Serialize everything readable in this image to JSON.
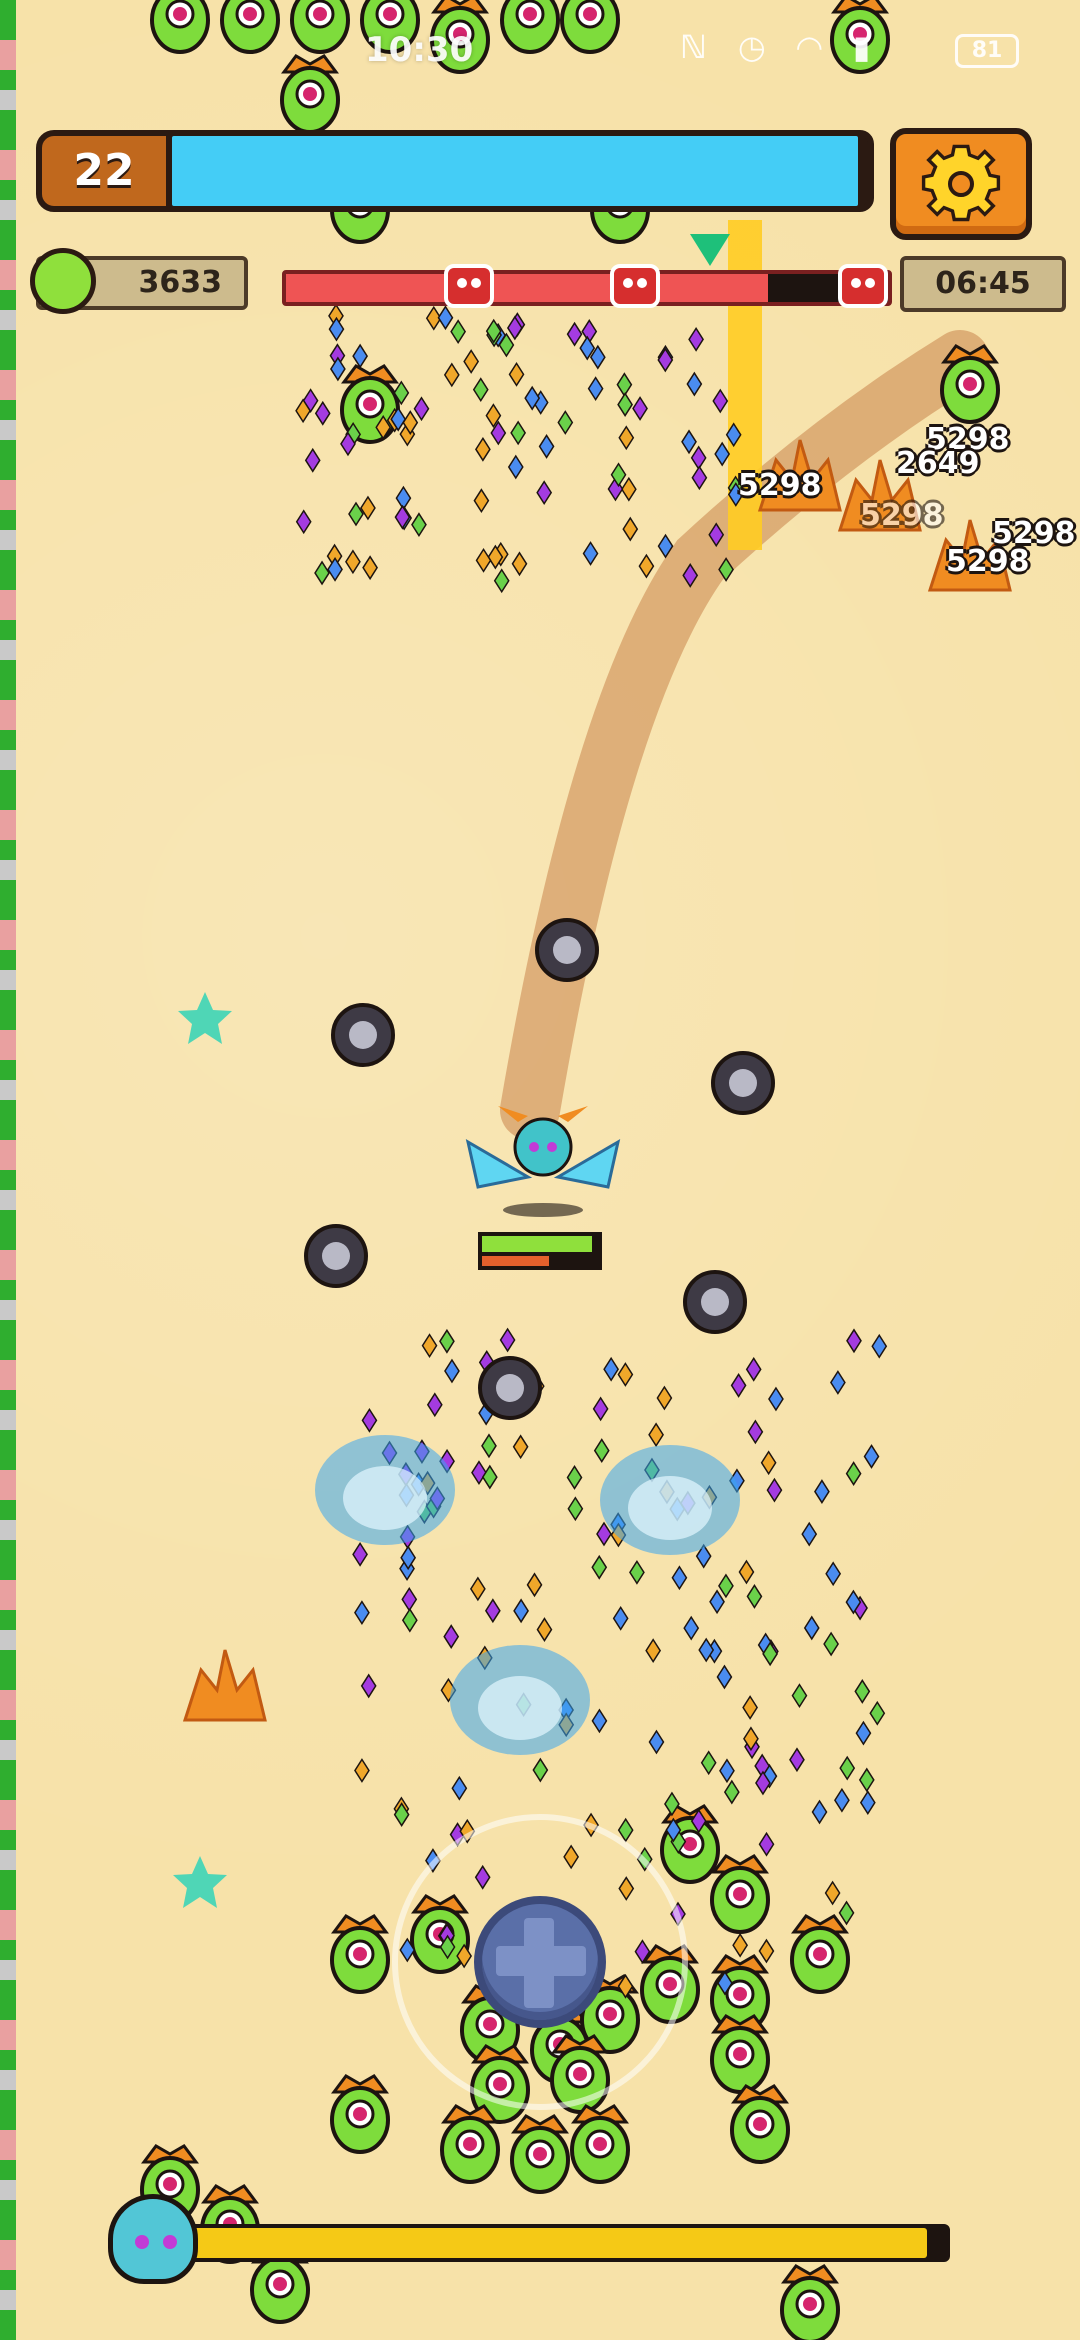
{
  "status_bar": {
    "time": "10:30",
    "icons": [
      "nfc-icon",
      "alarm-icon",
      "wifi-icon",
      "signal-icon"
    ],
    "battery": "81"
  },
  "hud": {
    "level": "22",
    "xp_progress": 0.985,
    "gems": "3633",
    "timer": "06:45",
    "boss_progress": 0.8,
    "settings_icon": "gear-icon"
  },
  "damage_numbers": [
    "5298",
    "2649",
    "5298",
    "5298",
    "5298",
    "5298"
  ],
  "player": {
    "hp_progress": 0.95
  },
  "hero_bar": {
    "progress": 0.975
  },
  "colors": {
    "sand": "#f7e2a9",
    "xp": "#44cdf6",
    "boss": "#ef5454",
    "hp": "#8fe03c",
    "hero": "#f5c916",
    "accent": "#f08c21"
  }
}
